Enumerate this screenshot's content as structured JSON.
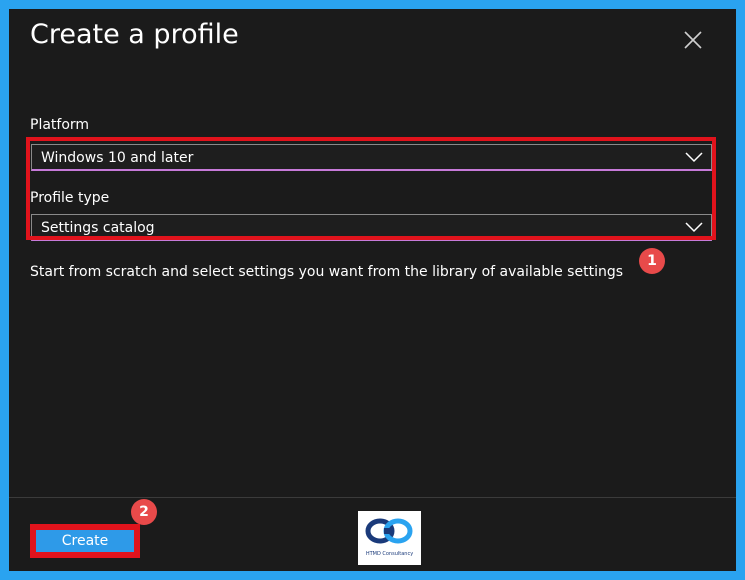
{
  "dialog": {
    "title": "Create a profile",
    "close_icon": "close-icon"
  },
  "platform": {
    "label": "Platform",
    "value": "Windows 10 and later",
    "chevron_icon": "chevron-down-icon"
  },
  "profile_type": {
    "label": "Profile type",
    "value": "Settings catalog",
    "chevron_icon": "chevron-down-icon"
  },
  "description": "Start from scratch and select settings you want from the library of available settings",
  "annotations": {
    "badge_1": "1",
    "badge_2": "2",
    "highlight_color": "#e1131c"
  },
  "footer": {
    "create_label": "Create",
    "logo_text": "HTMD Consultancy"
  },
  "colors": {
    "frame": "#2aa3f0",
    "panel": "#1b1b1b",
    "button": "#2e9ae8",
    "focus_underline": "#c77ad9"
  }
}
